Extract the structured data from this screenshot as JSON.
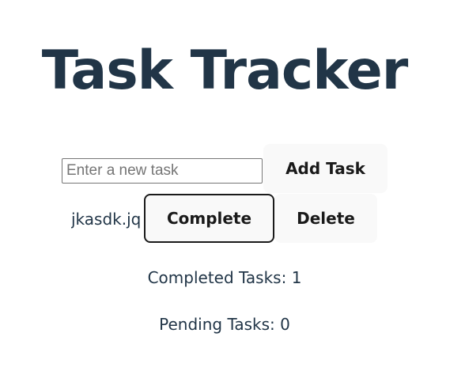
{
  "app": {
    "title": "Task Tracker"
  },
  "form": {
    "input_value": "",
    "input_placeholder": "Enter a new task",
    "add_label": "Add Task"
  },
  "tasks": [
    {
      "text": "jkasdk.jq",
      "complete_label": "Complete",
      "delete_label": "Delete"
    }
  ],
  "stats": {
    "completed": "Completed Tasks: 1",
    "pending": "Pending Tasks: 0"
  }
}
